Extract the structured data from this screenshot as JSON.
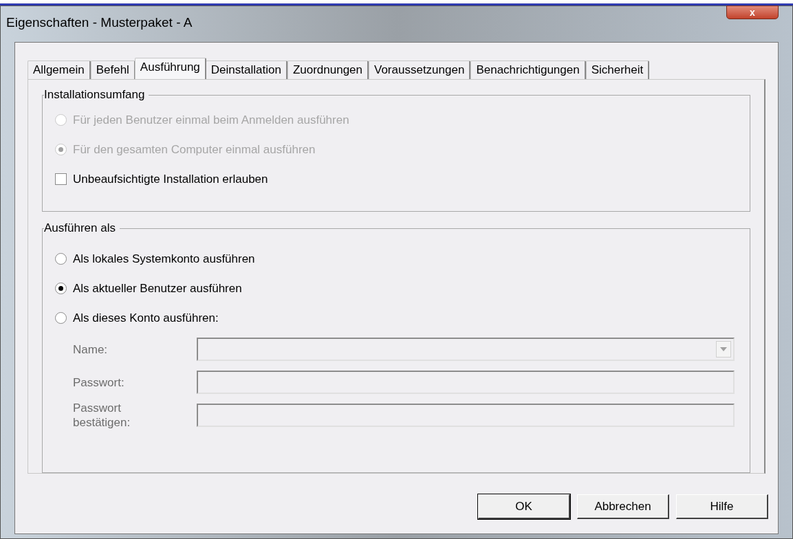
{
  "window": {
    "title": "Eigenschaften - Musterpaket - A",
    "close": "x"
  },
  "tabs": [
    {
      "label": "Allgemein",
      "selected": false
    },
    {
      "label": "Befehl",
      "selected": false
    },
    {
      "label": "Ausführung",
      "selected": true
    },
    {
      "label": "Deinstallation",
      "selected": false
    },
    {
      "label": "Zuordnungen",
      "selected": false
    },
    {
      "label": "Voraussetzungen",
      "selected": false
    },
    {
      "label": "Benachrichtigungen",
      "selected": false
    },
    {
      "label": "Sicherheit",
      "selected": false
    }
  ],
  "groups": [
    {
      "title": "Installationsumfang",
      "items": [
        {
          "kind": "radio",
          "label": "Für jeden Benutzer einmal beim Anmelden ausführen",
          "selected": false,
          "disabled": true
        },
        {
          "kind": "radio",
          "label": "Für den gesamten Computer einmal ausführen",
          "selected": true,
          "disabled": true
        },
        {
          "kind": "checkbox",
          "label": "Unbeaufsichtigte Installation erlauben",
          "checked": false,
          "disabled": false
        }
      ]
    },
    {
      "title": "Ausführen als",
      "items": [
        {
          "kind": "radio",
          "label": "Als lokales Systemkonto ausführen",
          "selected": false,
          "disabled": false
        },
        {
          "kind": "radio",
          "label": "Als aktueller Benutzer ausführen",
          "selected": true,
          "disabled": false
        },
        {
          "kind": "radio",
          "label": "Als dieses Konto ausführen:",
          "selected": false,
          "disabled": false
        }
      ],
      "fields": [
        {
          "kind": "dropdown",
          "label": "Name:",
          "disabled": true
        },
        {
          "kind": "text",
          "label": "Passwort:",
          "disabled": true
        },
        {
          "kind": "text",
          "label": "Passwort bestätigen:",
          "disabled": true
        }
      ]
    }
  ],
  "buttons": [
    {
      "label": "OK",
      "default": true
    },
    {
      "label": "Abbrechen",
      "default": false
    },
    {
      "label": "Hilfe",
      "default": false
    }
  ]
}
